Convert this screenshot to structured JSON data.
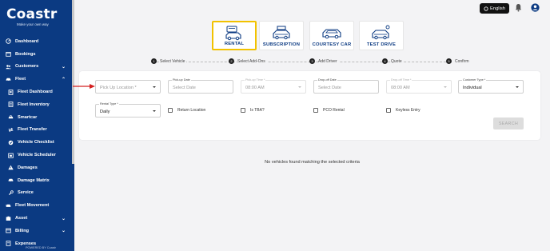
{
  "logo": {
    "text": "Coastr",
    "tagline": "Make your own way"
  },
  "sidebar": {
    "items": [
      {
        "label": "Dashboard",
        "icon": "dashboard-icon",
        "sub": false,
        "chevron": ""
      },
      {
        "label": "Bookings",
        "icon": "calendar-icon",
        "sub": false,
        "chevron": ""
      },
      {
        "label": "Customers",
        "icon": "people-icon",
        "sub": false,
        "chevron": "⌄"
      },
      {
        "label": "Fleet",
        "icon": "car-icon",
        "sub": false,
        "chevron": "⌃"
      },
      {
        "label": "Fleet Dashboard",
        "icon": "fleet-dashboard-icon",
        "sub": true,
        "chevron": ""
      },
      {
        "label": "Fleet Inventory",
        "icon": "inventory-icon",
        "sub": true,
        "chevron": ""
      },
      {
        "label": "Smartcar",
        "icon": "smartcar-icon",
        "sub": true,
        "chevron": ""
      },
      {
        "label": "Fleet Transfer",
        "icon": "transfer-icon",
        "sub": true,
        "chevron": ""
      },
      {
        "label": "Vehicle Checklist",
        "icon": "checklist-icon",
        "sub": true,
        "chevron": ""
      },
      {
        "label": "Vehicle Scheduler",
        "icon": "scheduler-icon",
        "sub": true,
        "chevron": ""
      },
      {
        "label": "Damages",
        "icon": "warning-icon",
        "sub": true,
        "chevron": ""
      },
      {
        "label": "Damage Matrix",
        "icon": "matrix-icon",
        "sub": true,
        "chevron": ""
      },
      {
        "label": "Service",
        "icon": "wrench-icon",
        "sub": true,
        "chevron": ""
      },
      {
        "label": "Fleet Movement",
        "icon": "movement-icon",
        "sub": false,
        "chevron": ""
      },
      {
        "label": "Asset",
        "icon": "asset-icon",
        "sub": false,
        "chevron": "⌄"
      },
      {
        "label": "Billing",
        "icon": "billing-icon",
        "sub": false,
        "chevron": "⌄"
      },
      {
        "label": "Expenses",
        "icon": "expenses-icon",
        "sub": false,
        "chevron": ""
      }
    ],
    "footer": "POWERED BY Coastr"
  },
  "topbar": {
    "language": "English"
  },
  "rental_types": [
    {
      "label": "RENTAL",
      "icon": "rental-car-icon",
      "active": true
    },
    {
      "label": "SUBSCRIPTION",
      "icon": "subscription-car-icon",
      "active": false
    },
    {
      "label": "COURTESY CAR",
      "icon": "courtesy-car-icon",
      "active": false
    },
    {
      "label": "TEST DRIVE",
      "icon": "test-drive-icon",
      "active": false
    }
  ],
  "steps": [
    {
      "num": "1",
      "label": "Select Vehicle"
    },
    {
      "num": "2",
      "label": "Select Add-Ons"
    },
    {
      "num": "3",
      "label": "Add Driver"
    },
    {
      "num": "4",
      "label": "Quote"
    },
    {
      "num": "5",
      "label": "Confirm"
    }
  ],
  "form": {
    "pickup_location": {
      "placeholder": "Pick Up Location *"
    },
    "pickup_date": {
      "label": "Pick-up Date",
      "placeholder": "Select Date"
    },
    "pickup_time": {
      "label": "Pick-up Time *",
      "value": "08:00 AM"
    },
    "dropoff_date": {
      "label": "Drop-off Date",
      "placeholder": "Select Date"
    },
    "dropoff_time": {
      "label": "Drop-off Time *",
      "value": "08:00 AM"
    },
    "customer_type": {
      "label": "Customer Type *",
      "value": "Individual"
    },
    "rental_type": {
      "label": "Rental Type *",
      "value": "Daily"
    },
    "checkboxes": [
      "Return Location",
      "Is TBA?",
      "PCO Rental",
      "Keyless Entry"
    ],
    "search_label": "SEARCH"
  },
  "empty_message": "No vehicles found matching the selected criteria",
  "colors": {
    "sidebar": "#0b3a82",
    "accent": "#f2c200",
    "arrow": "#d42020"
  }
}
